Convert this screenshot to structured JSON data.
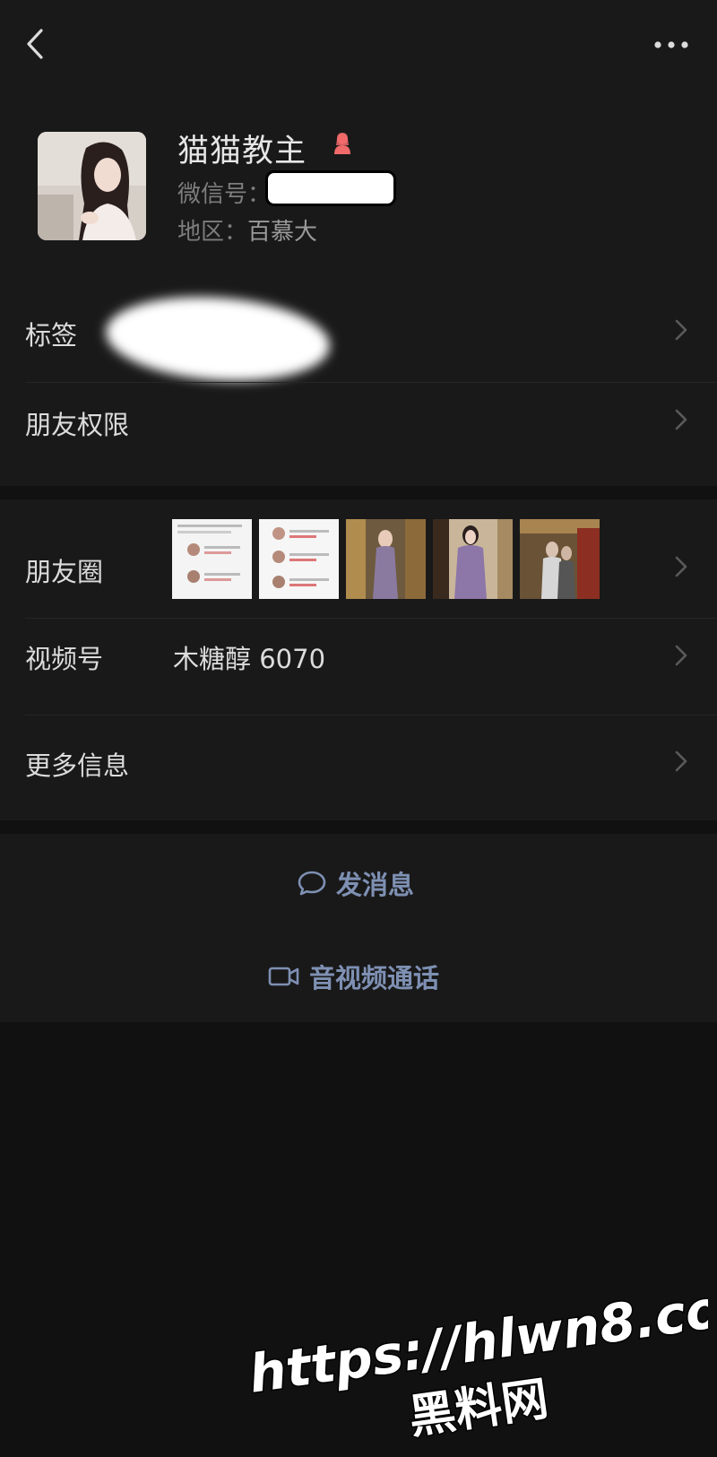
{
  "header": {
    "back_icon": "chevron-left-icon",
    "more_icon": "ellipsis-icon"
  },
  "profile": {
    "nickname": "猫猫教主",
    "gender_icon": "female-icon",
    "gender_color": "#f06a6a",
    "wechat_id_label": "微信号：",
    "region_label": "地区：",
    "region_value": "百慕大"
  },
  "rows": {
    "tags": {
      "label": "标签"
    },
    "permissions": {
      "label": "朋友权限"
    },
    "moments": {
      "label": "朋友圈"
    },
    "channels": {
      "label": "视频号",
      "value": "木糖醇 6070"
    },
    "more_info": {
      "label": "更多信息"
    }
  },
  "actions": {
    "message": {
      "label": "发消息",
      "icon": "chat-bubble-icon"
    },
    "call": {
      "label": "音视频通话",
      "icon": "video-camera-icon"
    }
  },
  "colors": {
    "background": "#111111",
    "surface": "#191919",
    "link": "#7e90b3"
  }
}
